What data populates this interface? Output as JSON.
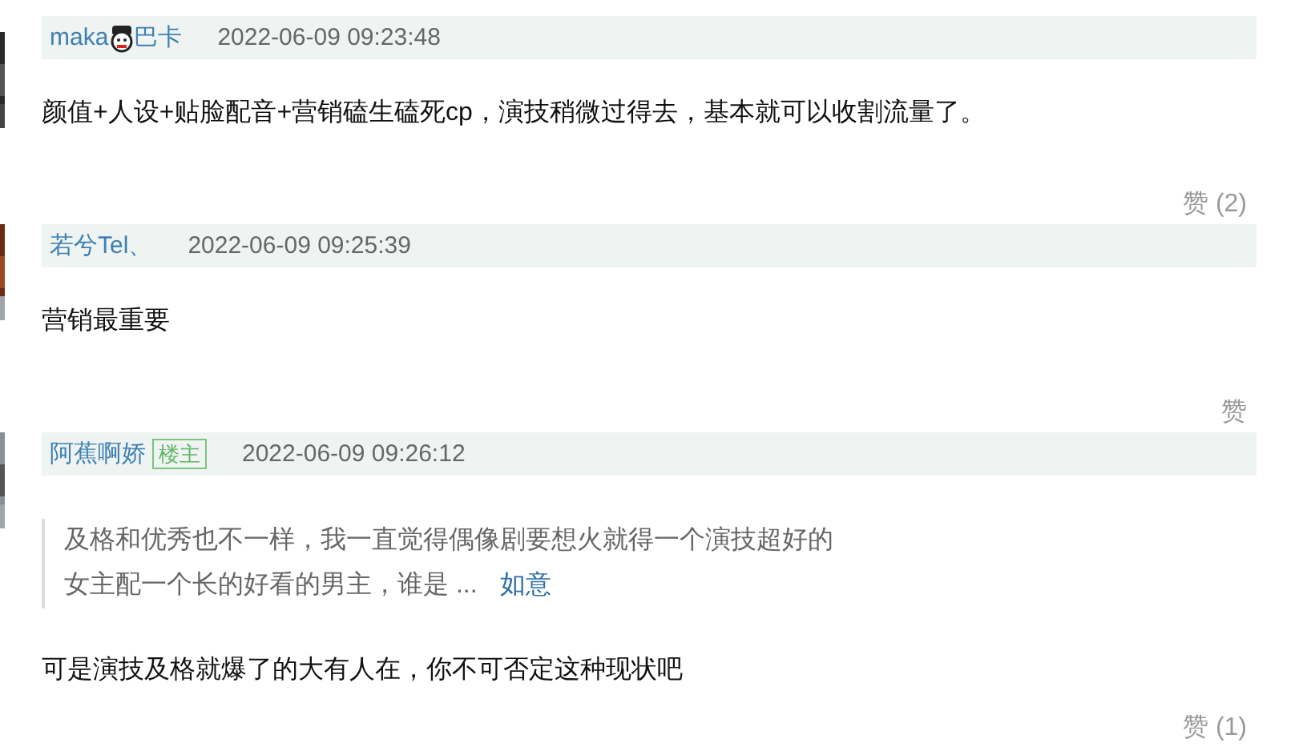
{
  "comments": [
    {
      "name_parts": [
        "maka",
        "巴卡"
      ],
      "time": "2022-06-09 09:23:48",
      "text": "颜值+人设+贴脸配音+营销磕生磕死cp，演技稍微过得去，基本就可以收割流量了。",
      "like": "赞 (2)"
    },
    {
      "name_parts": [
        "若兮Tel、"
      ],
      "time": "2022-06-09 09:25:39",
      "text": "营销最重要",
      "like": "赞"
    },
    {
      "name_parts": [
        "阿蕉啊娇"
      ],
      "badge": "楼主",
      "time": "2022-06-09 09:26:12",
      "quote": {
        "lines": [
          "及格和优秀也不一样，我一直觉得偶像剧要想火就得一个演技超好的",
          "女主配一个长的好看的男主，谁是 ..."
        ],
        "author": "如意"
      },
      "text": "可是演技及格就爆了的大有人在，你不可否定这种现状吧",
      "like": "赞 (1)"
    }
  ]
}
